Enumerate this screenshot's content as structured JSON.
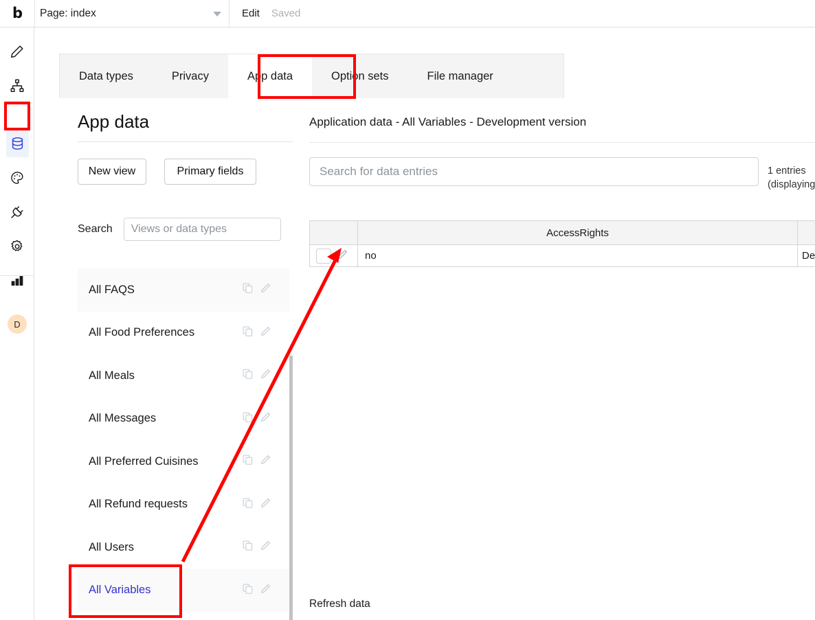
{
  "topbar": {
    "logo": "b",
    "page_label": "Page: index",
    "edit_label": "Edit",
    "status_label": "Saved"
  },
  "rail": {
    "items": [
      {
        "icon": "pencil-icon",
        "name": "design"
      },
      {
        "icon": "workflow-icon",
        "name": "workflow"
      },
      {
        "icon": "database-icon",
        "name": "data",
        "selected": true
      },
      {
        "icon": "palette-icon",
        "name": "styles"
      },
      {
        "icon": "plugin-icon",
        "name": "plugins"
      },
      {
        "icon": "gear-icon",
        "name": "settings"
      },
      {
        "icon": "bar-chart-icon",
        "name": "logs"
      }
    ],
    "avatar_initial": "D"
  },
  "tabs": [
    {
      "label": "Data types",
      "active": false
    },
    {
      "label": "Privacy",
      "active": false
    },
    {
      "label": "App data",
      "active": true
    },
    {
      "label": "Option sets",
      "active": false
    },
    {
      "label": "File manager",
      "active": false
    }
  ],
  "left_panel": {
    "title": "App data",
    "new_view_label": "New view",
    "primary_fields_label": "Primary fields",
    "search_label": "Search",
    "search_placeholder": "Views or data types",
    "search_value": "",
    "views": [
      {
        "label": "All FAQS",
        "selected": false,
        "shaded": true
      },
      {
        "label": "All Food Preferences",
        "selected": false,
        "shaded": false
      },
      {
        "label": "All Meals",
        "selected": false,
        "shaded": false
      },
      {
        "label": "All Messages",
        "selected": false,
        "shaded": false
      },
      {
        "label": "All Preferred Cuisines",
        "selected": false,
        "shaded": false
      },
      {
        "label": "All Refund requests",
        "selected": false,
        "shaded": false
      },
      {
        "label": "All Users",
        "selected": false,
        "shaded": false
      },
      {
        "label": "All Variables",
        "selected": true,
        "shaded": true
      }
    ]
  },
  "right_panel": {
    "title": "Application data - All Variables - Development version",
    "search_placeholder": "Search for data entries",
    "search_value": "",
    "entries_count_line1": "1 entries",
    "entries_count_line2": "(displaying",
    "table": {
      "columns": [
        "",
        "AccessRights",
        ""
      ],
      "rows": [
        {
          "access_rights": "no",
          "next_column": "Dec"
        }
      ]
    },
    "refresh_label": "Refresh data"
  },
  "annotations": {
    "color": "#ff0000",
    "boxes": [
      "database-rail-icon",
      "app-data-tab",
      "all-variables-list-item"
    ],
    "arrow": {
      "from": "all-variables-list-item",
      "to": "row-edit-pencil-icon"
    }
  }
}
